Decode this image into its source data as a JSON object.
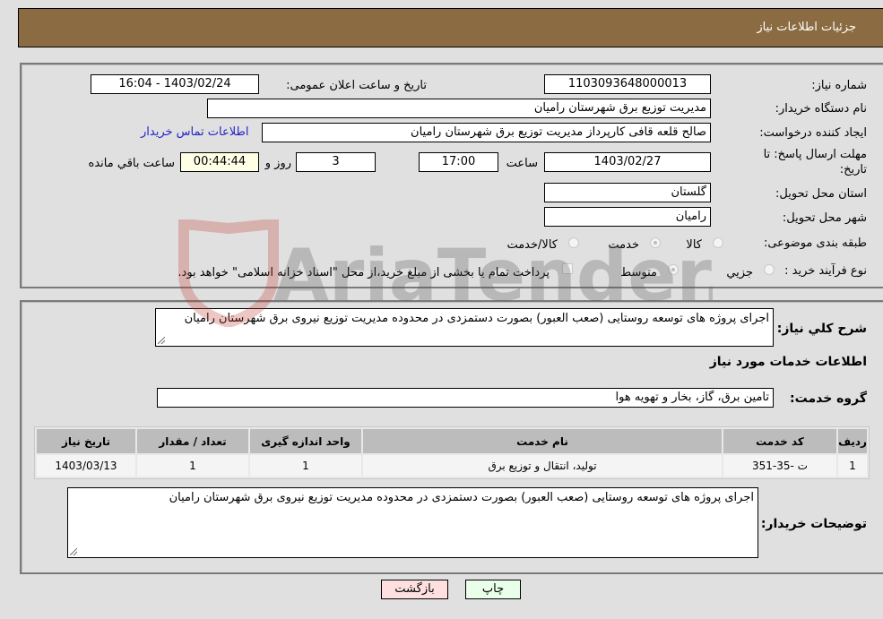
{
  "header": {
    "title": "جزئیات اطلاعات نیاز"
  },
  "form": {
    "need_number": {
      "label": "شماره نیاز:",
      "value": "1103093648000013"
    },
    "announce_datetime": {
      "label": "تاریخ و ساعت اعلان عمومی:",
      "value": "1403/02/24 - 16:04"
    },
    "buyer_org": {
      "label": "نام دستگاه خریدار:",
      "value": "مدیریت توزیع برق شهرستان رامیان"
    },
    "requester": {
      "label": "ایجاد کننده درخواست:",
      "value": "صالح قلعه قافی کارپرداز مدیریت توزیع برق شهرستان رامیان"
    },
    "contact_link": "اطلاعات تماس خریدار",
    "deadline": {
      "label_line1": "مهلت ارسال پاسخ: تا",
      "label_line2": "تاریخ:",
      "date": "1403/02/27",
      "time_label": "ساعت",
      "time": "17:00",
      "days": "3",
      "days_label": "روز و",
      "remaining": "00:44:44",
      "remaining_label": "ساعت باقي مانده"
    },
    "province": {
      "label": "استان محل تحویل:",
      "value": "گلستان"
    },
    "city": {
      "label": "شهر محل تحویل:",
      "value": "رامیان"
    },
    "category": {
      "label": "طبقه بندی موضوعی:",
      "options": [
        "کالا",
        "خدمت",
        "کالا/خدمت"
      ],
      "selected": "خدمت"
    },
    "purchase_type": {
      "label": "نوع فرآیند خرید :",
      "options": [
        "جزيي",
        "متوسط"
      ],
      "selected": "متوسط",
      "treasury_note": "پرداخت تمام یا بخشی از مبلغ خرید،از محل \"اسناد خزانه اسلامی\" خواهد بود."
    }
  },
  "description": {
    "label": "شرح کلي نياز:",
    "value": "اجرای پروژه های توسعه روستایی (صعب العبور) بصورت دستمزدی در محدوده مدیریت توزیع نیروی برق شهرستان رامیان"
  },
  "services": {
    "title": "اطلاعات خدمات مورد نیاز",
    "group_label": "گروه خدمت:",
    "group_value": "تامین برق، گاز، بخار و تهویه هوا",
    "table": {
      "headers": [
        "ردیف",
        "کد خدمت",
        "نام خدمت",
        "واحد اندازه گیری",
        "تعداد / مقدار",
        "تاریخ نیاز"
      ],
      "rows": [
        [
          "1",
          "ت -35-351",
          "تولید، انتقال و توزیع برق",
          "1",
          "1",
          "1403/03/13"
        ]
      ]
    }
  },
  "buyer_notes": {
    "label": "توضیحات خریدار:",
    "value": "اجرای پروژه های توسعه روستایی (صعب العبور) بصورت دستمزدی در محدوده مدیریت توزیع نیروی برق شهرستان رامیان"
  },
  "buttons": {
    "print": "چاپ",
    "back": "بازگشت"
  },
  "colors": {
    "header_bg": "#8b6c42",
    "print_bg": "#e9ffe9",
    "back_bg": "#ffe0e0",
    "link": "#2323c8"
  },
  "watermark": {
    "text": "AriaTender.neT"
  }
}
